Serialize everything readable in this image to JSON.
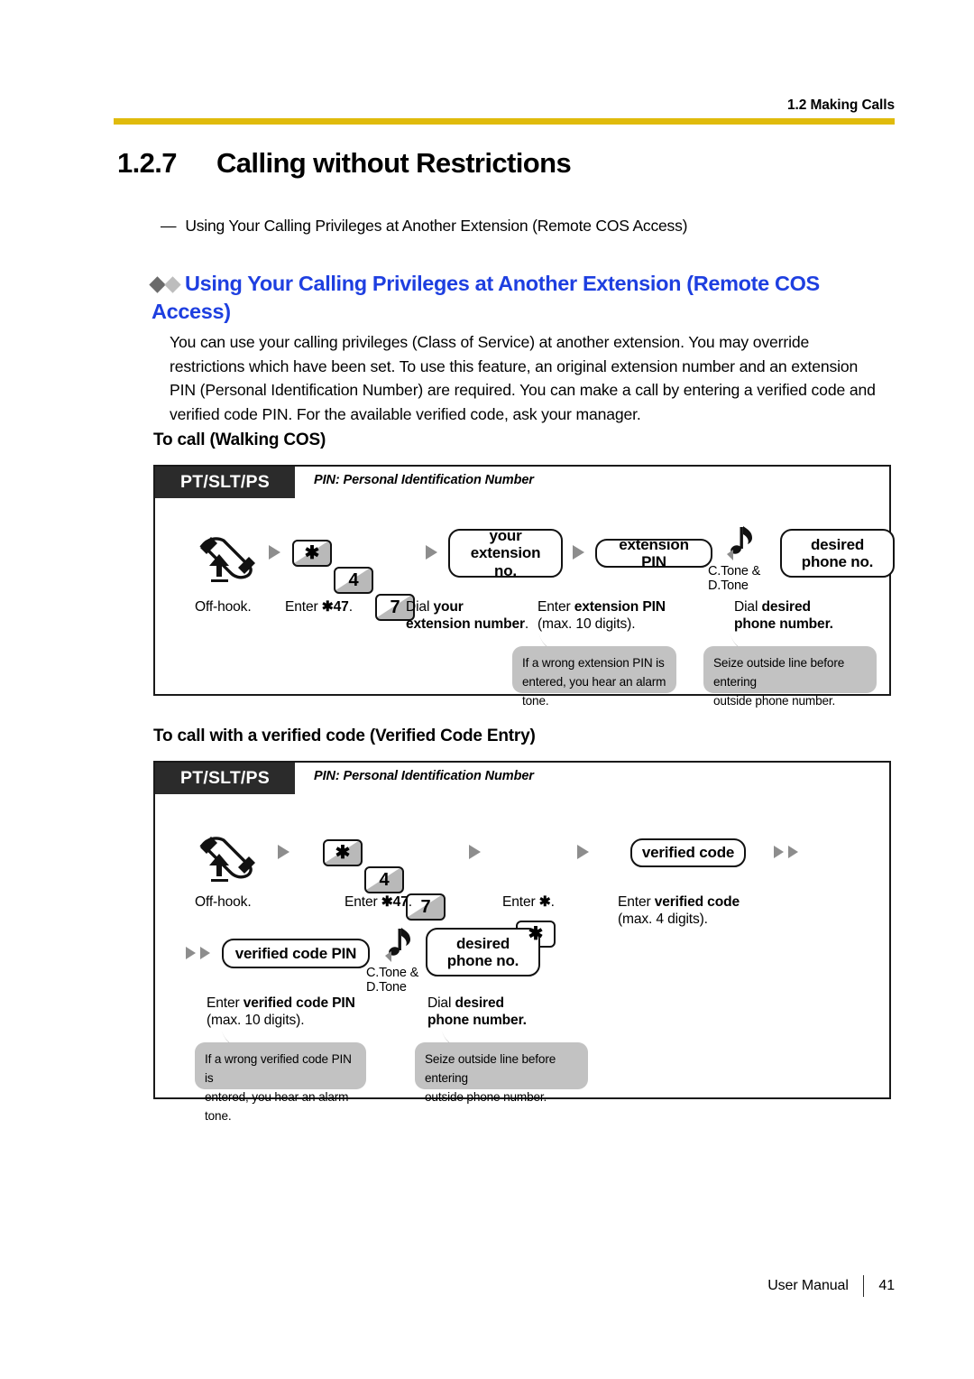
{
  "header": {
    "running_head": "1.2 Making Calls",
    "rule_color": "#e0bb0c"
  },
  "section": {
    "number": "1.2.7",
    "title": "Calling without Restrictions",
    "toc_dash": "—",
    "toc_entry": "Using Your Calling Privileges at Another Extension (Remote COS Access)"
  },
  "feature": {
    "heading": "Using Your Calling Privileges at Another Extension (Remote COS Access)",
    "heading_color": "#1e3fe0",
    "bullet1_color": "#6b6b6b",
    "bullet2_color": "#bdbdbd",
    "paragraph": "You can use your calling privileges (Class of Service) at another extension. You may override restrictions which have been set. To use this feature, an original extension number and an extension PIN (Personal Identification Number) are required. You can make a call by entering a verified code and verified code PIN. For the available verified code, ask your manager."
  },
  "procedure1": {
    "subhead": "To call (Walking COS)",
    "device_tag": "PT/SLT/PS",
    "pin_note": "PIN: Personal Identification Number",
    "steps": {
      "handset_icon": "off-hook-handset-icon",
      "key_star": "✱",
      "key_4": "4",
      "key_7": "7",
      "pill_ext_line1": "your",
      "pill_ext_line2": "extension no.",
      "pill_ext_pin": "extension PIN",
      "tone_icon": "tone-note-icon",
      "tone_label_line1": "C.Tone &",
      "tone_label_line2": "D.Tone",
      "pill_phone_line1": "desired",
      "pill_phone_line2": "phone no."
    },
    "captions": {
      "c1": "Off-hook.",
      "c2_plain": "Enter ",
      "c2_bold": "✱47",
      "c2_tail": ".",
      "c3_line1_plain": "Dial ",
      "c3_line1_bold": "your",
      "c3_line2_bold": "extension number",
      "c3_line2_tail": ".",
      "c4_line1_plain": "Enter ",
      "c4_line1_bold": "extension PIN",
      "c4_line2": "(max. 10 digits).",
      "c5_line1_plain": "Dial ",
      "c5_line1_bold": "desired",
      "c5_line2_bold": "phone number."
    },
    "callouts": {
      "b1_line1": "If a wrong extension PIN is",
      "b1_line2": "entered, you hear an alarm tone.",
      "b2_line1": "Seize outside line before entering",
      "b2_line2": "outside phone number."
    }
  },
  "procedure2": {
    "subhead": "To call with a verified code (Verified Code Entry)",
    "device_tag": "PT/SLT/PS",
    "pin_note": "PIN: Personal Identification Number",
    "steps": {
      "handset_icon": "off-hook-handset-icon",
      "key_star": "✱",
      "key_4": "4",
      "key_7": "7",
      "key_star2": "✱",
      "pill_verified_code": "verified code",
      "pill_verified_code_pin": "verified code PIN",
      "tone_icon": "tone-note-icon",
      "tone_label_line1": "C.Tone &",
      "tone_label_line2": "D.Tone",
      "pill_phone_line1": "desired",
      "pill_phone_line2": "phone no."
    },
    "captions": {
      "c1": "Off-hook.",
      "c2_plain": "Enter ",
      "c2_bold": "✱47",
      "c2_tail": ".",
      "c3_plain": "Enter ",
      "c3_bold": "✱",
      "c3_tail": ".",
      "c4_line1_plain": "Enter ",
      "c4_line1_bold": "verified code",
      "c4_line2": "(max. 4 digits).",
      "c5_line1_plain": "Enter ",
      "c5_line1_bold": "verified code PIN",
      "c5_line2": "(max. 10 digits).",
      "c6_line1_plain": "Dial ",
      "c6_line1_bold": "desired",
      "c6_line2_bold": "phone number."
    },
    "callouts": {
      "b1_line1": "If a wrong verified code PIN is",
      "b1_line2": "entered, you hear an alarm tone.",
      "b2_line1": "Seize outside line before entering",
      "b2_line2": "outside phone number."
    }
  },
  "footer": {
    "doc_name": "User Manual",
    "page_number": "41"
  }
}
